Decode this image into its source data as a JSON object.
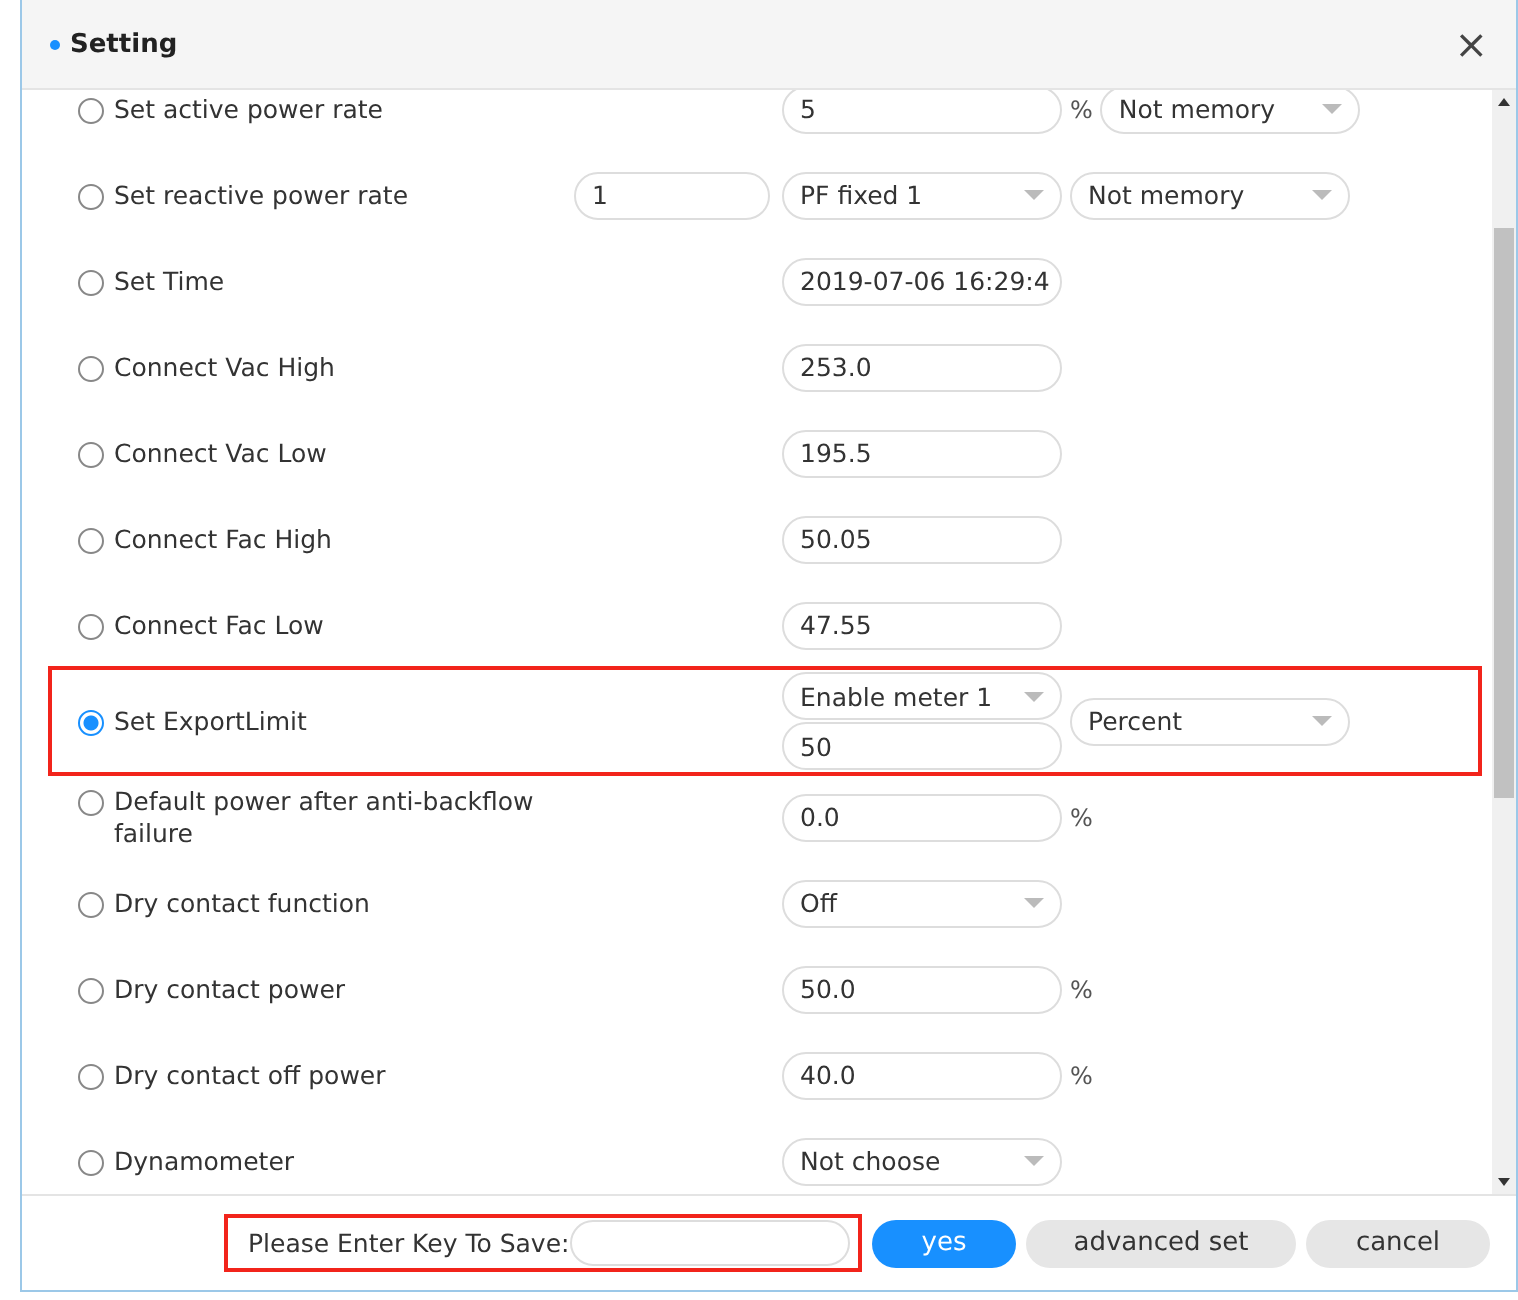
{
  "dialog": {
    "title": "Setting",
    "close": "×"
  },
  "rows": [
    {
      "label": "Set active power rate",
      "selected": false,
      "highlighted": false,
      "extra": [],
      "main": [
        {
          "kind": "input",
          "value": "5"
        }
      ],
      "side": [
        {
          "kind": "unit",
          "value": "%"
        },
        {
          "kind": "select",
          "value": "Not memory"
        }
      ]
    },
    {
      "label": "Set reactive power rate",
      "selected": false,
      "highlighted": false,
      "extra": [
        {
          "kind": "input",
          "value": "1"
        }
      ],
      "main": [
        {
          "kind": "select",
          "value": "PF fixed 1"
        }
      ],
      "side": [
        {
          "kind": "select",
          "value": "Not memory"
        }
      ]
    },
    {
      "label": "Set Time",
      "selected": false,
      "highlighted": false,
      "extra": [],
      "main": [
        {
          "kind": "input",
          "value": "2019-07-06 16:29:4"
        }
      ],
      "side": []
    },
    {
      "label": "Connect Vac High",
      "selected": false,
      "highlighted": false,
      "extra": [],
      "main": [
        {
          "kind": "input",
          "value": "253.0"
        }
      ],
      "side": []
    },
    {
      "label": "Connect Vac Low",
      "selected": false,
      "highlighted": false,
      "extra": [],
      "main": [
        {
          "kind": "input",
          "value": "195.5"
        }
      ],
      "side": []
    },
    {
      "label": "Connect Fac High",
      "selected": false,
      "highlighted": false,
      "extra": [],
      "main": [
        {
          "kind": "input",
          "value": "50.05"
        }
      ],
      "side": []
    },
    {
      "label": "Connect Fac Low",
      "selected": false,
      "highlighted": false,
      "extra": [],
      "main": [
        {
          "kind": "input",
          "value": "47.55"
        }
      ],
      "side": []
    },
    {
      "label": "Set ExportLimit",
      "selected": true,
      "highlighted": true,
      "extra": [],
      "main": [
        {
          "kind": "select",
          "value": "Enable meter 1"
        },
        {
          "kind": "input",
          "value": "50"
        }
      ],
      "side": [
        {
          "kind": "select",
          "value": "Percent"
        }
      ]
    },
    {
      "label": "Default power after anti-backflow failure",
      "selected": false,
      "highlighted": false,
      "extra": [],
      "main": [
        {
          "kind": "input",
          "value": "0.0"
        }
      ],
      "side": [
        {
          "kind": "unit",
          "value": "%"
        }
      ]
    },
    {
      "label": "Dry contact function",
      "selected": false,
      "highlighted": false,
      "extra": [],
      "main": [
        {
          "kind": "select",
          "value": "Off"
        }
      ],
      "side": []
    },
    {
      "label": "Dry contact power",
      "selected": false,
      "highlighted": false,
      "extra": [],
      "main": [
        {
          "kind": "input",
          "value": "50.0"
        }
      ],
      "side": [
        {
          "kind": "unit",
          "value": "%"
        }
      ]
    },
    {
      "label": "Dry contact off power",
      "selected": false,
      "highlighted": false,
      "extra": [],
      "main": [
        {
          "kind": "input",
          "value": "40.0"
        }
      ],
      "side": [
        {
          "kind": "unit",
          "value": "%"
        }
      ]
    },
    {
      "label": "Dynamometer",
      "selected": false,
      "highlighted": false,
      "extra": [],
      "main": [
        {
          "kind": "select",
          "value": "Not choose"
        }
      ],
      "side": []
    }
  ],
  "footer": {
    "key_label": "Please Enter Key To Save:",
    "key_highlighted": true,
    "buttons": [
      {
        "label": "yes",
        "kind": "primary"
      },
      {
        "label": "advanced set",
        "kind": "secondary"
      },
      {
        "label": "cancel",
        "kind": "secondary"
      }
    ]
  }
}
